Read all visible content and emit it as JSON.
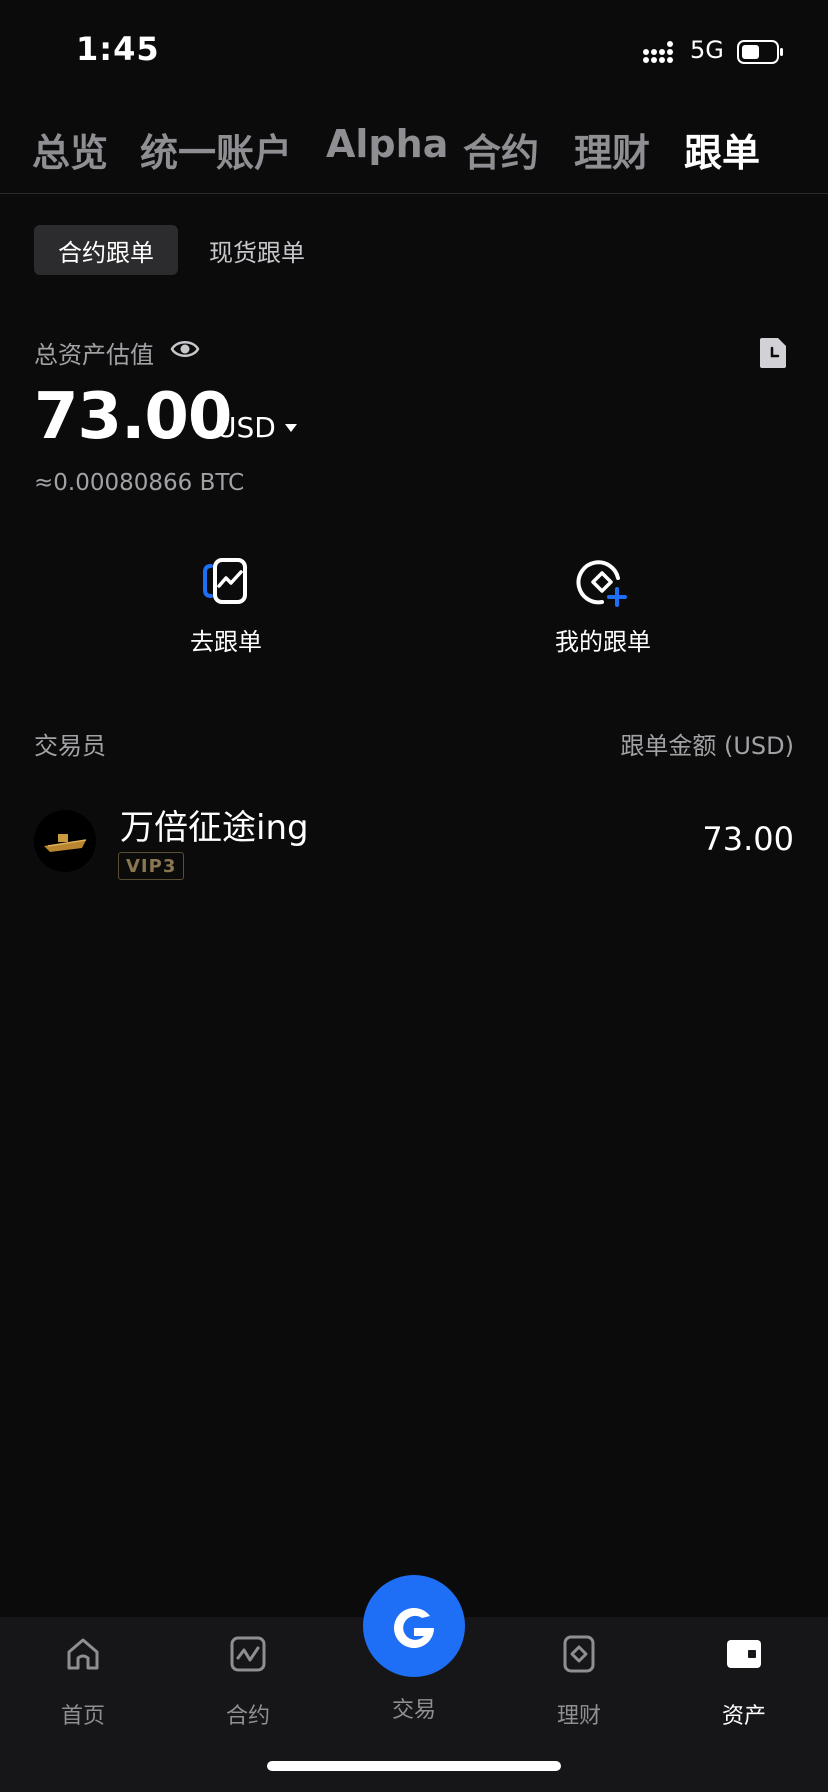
{
  "status_bar": {
    "time": "1:45",
    "network": "5G",
    "battery_percent": 50
  },
  "top_tabs": [
    {
      "label": "总览",
      "active": false
    },
    {
      "label": "统一账户",
      "active": false
    },
    {
      "label": "Alpha",
      "active": false
    },
    {
      "label": "合约",
      "active": false
    },
    {
      "label": "理财",
      "active": false
    },
    {
      "label": "跟单",
      "active": true
    }
  ],
  "sub_tabs": [
    {
      "label": "合约跟单",
      "active": true
    },
    {
      "label": "现货跟单",
      "active": false
    }
  ],
  "assets": {
    "label": "总资产估值",
    "amount": "73.00",
    "currency": "USD",
    "btc_equiv": "≈0.00080866 BTC"
  },
  "actions": {
    "go_copy": "去跟单",
    "my_copy": "我的跟单"
  },
  "list": {
    "col_trader": "交易员",
    "col_amount": "跟单金额 (USD)",
    "rows": [
      {
        "name": "万倍征途ing",
        "vip": "VIP3",
        "amount": "73.00"
      }
    ]
  },
  "bottom_nav": [
    {
      "label": "首页",
      "icon": "home-icon",
      "active": false
    },
    {
      "label": "合约",
      "icon": "chart-icon",
      "active": false
    },
    {
      "label": "交易",
      "icon": "trade-logo-icon",
      "active": false
    },
    {
      "label": "理财",
      "icon": "diamond-card-icon",
      "active": false
    },
    {
      "label": "资产",
      "icon": "wallet-icon",
      "active": true
    }
  ],
  "colors": {
    "background": "#0b0b0b",
    "accent_blue": "#1e6ff5",
    "muted_text": "#a1a1a6",
    "vip_gold": "#8a7650"
  }
}
